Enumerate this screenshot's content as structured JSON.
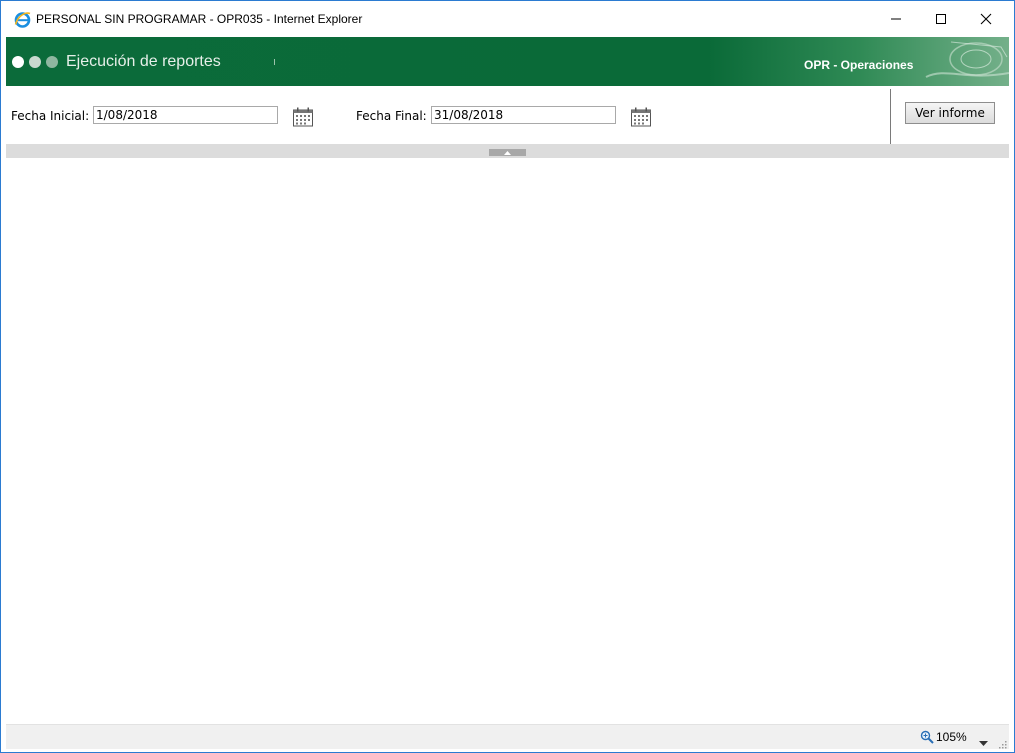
{
  "window": {
    "title": "PERSONAL SIN PROGRAMAR - OPR035 - Internet Explorer",
    "icon": "internet-explorer-icon"
  },
  "banner": {
    "title": "Ejecución de reportes",
    "module": "OPR - Operaciones"
  },
  "params": {
    "fecha_inicial_label": "Fecha Inicial:",
    "fecha_inicial_value": "1/08/2018",
    "fecha_final_label": "Fecha Final:",
    "fecha_final_value": "31/08/2018",
    "ver_informe_label": "Ver informe"
  },
  "status": {
    "zoom": "105%"
  },
  "colors": {
    "banner_green": "#0b6b3a",
    "window_border": "#2b7bd1"
  }
}
